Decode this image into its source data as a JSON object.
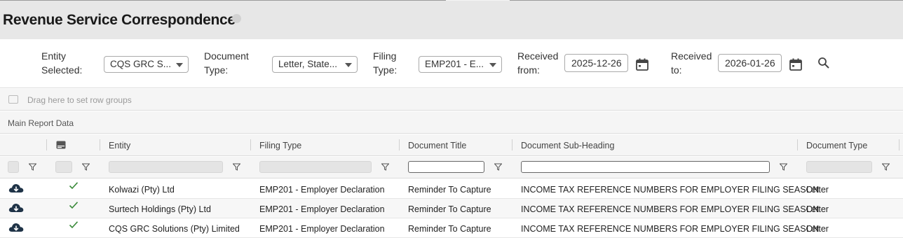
{
  "page": {
    "title": "Revenue Service Correspondence"
  },
  "filters": {
    "entity": {
      "label_line1": "Entity",
      "label_line2": "Selected:",
      "value": "CQS GRC S..."
    },
    "document_type": {
      "label_line1": "Document",
      "label_line2": "Type:",
      "value": "Letter, State..."
    },
    "filing_type": {
      "label_line1": "Filing",
      "label_line2": "Type:",
      "value": "EMP201 - E..."
    },
    "received_from": {
      "label_line1": "Received",
      "label_line2": "from:",
      "value": "2025-12-26"
    },
    "received_to": {
      "label_line1": "Received",
      "label_line2": "to:",
      "value": "2026-01-26"
    }
  },
  "grid": {
    "group_panel_text": "Drag here to set row groups",
    "section_title": "Main Report Data",
    "columns": [
      "Entity",
      "Filing Type",
      "Document Title",
      "Document Sub-Heading",
      "Document Type"
    ],
    "rows": [
      {
        "entity": "Kolwazi (Pty) Ltd",
        "filing_type": "EMP201 - Employer Declaration",
        "document_title": "Reminder To Capture",
        "sub_heading": "INCOME TAX REFERENCE NUMBERS FOR EMPLOYER FILING SEASON",
        "document_type": "Letter"
      },
      {
        "entity": "Surtech Holdings (Pty) Ltd",
        "filing_type": "EMP201 - Employer Declaration",
        "document_title": "Reminder To Capture",
        "sub_heading": "INCOME TAX REFERENCE NUMBERS FOR EMPLOYER FILING SEASON",
        "document_type": "Letter"
      },
      {
        "entity": "CQS GRC Solutions (Pty) Limited",
        "filing_type": "EMP201 - Employer Declaration",
        "document_title": "Reminder To Capture",
        "sub_heading": "INCOME TAX REFERENCE NUMBERS FOR EMPLOYER FILING SEASON",
        "document_type": "Letter"
      }
    ]
  },
  "colors": {
    "title_bar": "#e7e7e7",
    "grid_header": "#f5f5f5",
    "check": "#3a8a3a",
    "download_icon": "#1f3347"
  },
  "icons": [
    "info-icon",
    "caret-down-icon",
    "calendar-icon",
    "search-icon",
    "row-group-icon",
    "column-panel-icon",
    "filter-icon",
    "download-icon",
    "check-icon"
  ]
}
